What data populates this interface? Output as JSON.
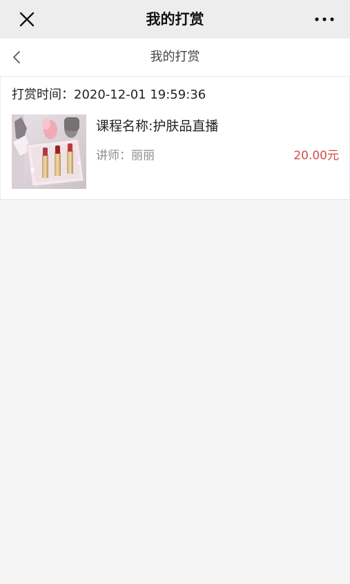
{
  "wechat_bar": {
    "title": "我的打赏",
    "close_icon": "close-icon",
    "more_icon": "more-dots-icon"
  },
  "nav": {
    "title": "我的打赏",
    "back_icon": "chevron-left-icon"
  },
  "reward": {
    "time_label": "打赏时间：2020-12-01 19:59:36",
    "thumbnail_icon": "lipstick-product-image",
    "course_name": "课程名称:护肤品直播",
    "teacher_label": "讲师：",
    "teacher_name": "丽丽",
    "amount": "20.00元"
  },
  "colors": {
    "top_bar_bg": "#ededed",
    "page_bg": "#f5f5f5",
    "price": "#d24b4b",
    "muted_text": "#8c8c8c"
  }
}
